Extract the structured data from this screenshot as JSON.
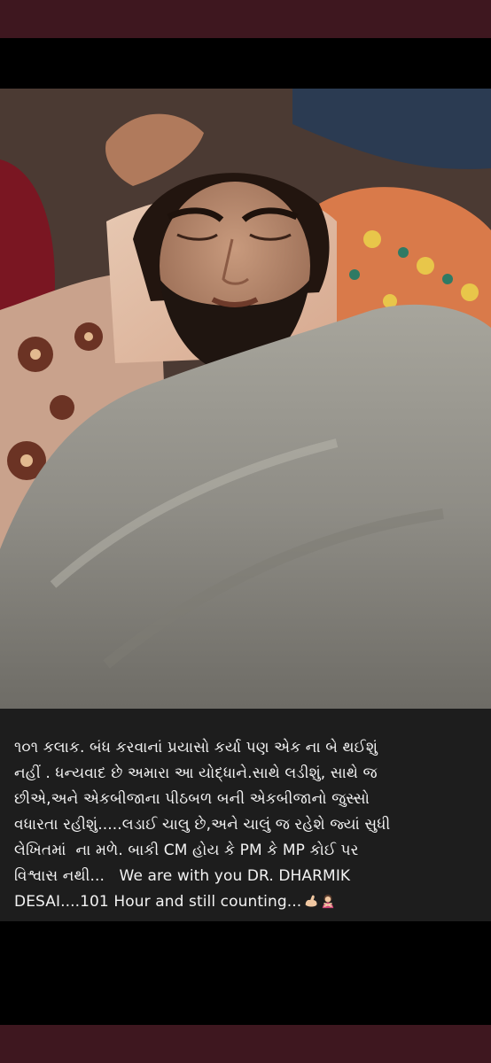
{
  "post": {
    "caption_gujarati": "૧૦૧ કલાક. બંધ કરવાનાં પ્રયાસો કર્યા પણ એક ના બે થઈશું\nનહીં . ધન્યવાદ છે અમારા આ યોદ્ધાને.સાથે લડીશું, સાથે જ\nછીએ,અને એકબીજાના પીઠબળ બની એકબીજાનો જુસ્સો\nવધારતા રહીશું.....લડાઈ ચાલુ છે,અને ચાલું જ રહેશે જ્યાં સુધી\nલેખિતમાં  ના મળે. બાકી CM હોય કે PM કે MP કોઈ પર\nવિશ્વાસ નથી...   ",
    "caption_english": "We are with you DR. DHARMIK\nDESAI....101 Hour and still counting...",
    "emojis": [
      "flexed-biceps-icon",
      "woman-gesturing-no-icon"
    ]
  },
  "colors": {
    "top_bar": "#3e171f",
    "bottom_bar": "#3e171f",
    "caption_bg": "#1d1d1d",
    "caption_text": "#f2f2f2"
  }
}
